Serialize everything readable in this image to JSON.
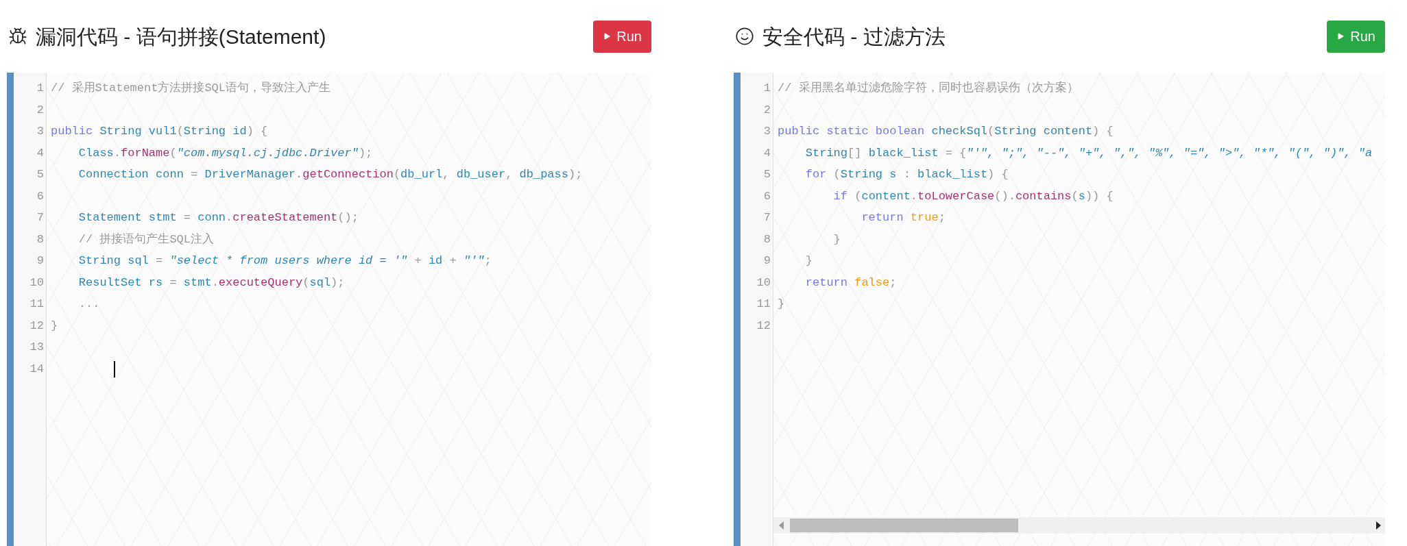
{
  "panels": [
    {
      "title": "漏洞代码 - 语句拼接(Statement)",
      "button": {
        "label": "Run"
      },
      "lines": [
        {
          "number": "1",
          "cursor": false,
          "tokens": [
            {
              "kind": "comment",
              "text": "// 采用Statement方法拼接SQL语句，导致注入产生"
            }
          ]
        },
        {
          "number": "2",
          "cursor": false
        },
        {
          "number": "3",
          "cursor": false,
          "tokens": [
            {
              "kind": "keyword",
              "text": "public "
            },
            {
              "kind": "type",
              "text": "String vul1"
            },
            {
              "kind": "punct",
              "text": "("
            },
            {
              "kind": "type",
              "text": "String id"
            },
            {
              "kind": "punct",
              "text": ") {"
            }
          ]
        },
        {
          "number": "4",
          "cursor": false,
          "tokens": [
            {
              "kind": "type",
              "text": "    Class"
            },
            {
              "kind": "punct",
              "text": "."
            },
            {
              "kind": "method",
              "text": "forName"
            },
            {
              "kind": "punct",
              "text": "("
            },
            {
              "kind": "string",
              "text": "\"com.mysql.cj.jdbc.Driver\""
            },
            {
              "kind": "punct",
              "text": ");"
            }
          ]
        },
        {
          "number": "5",
          "cursor": false,
          "tokens": [
            {
              "kind": "type",
              "text": "    Connection conn "
            },
            {
              "kind": "punct",
              "text": "= "
            },
            {
              "kind": "type",
              "text": "DriverManager"
            },
            {
              "kind": "punct",
              "text": "."
            },
            {
              "kind": "method",
              "text": "getConnection"
            },
            {
              "kind": "punct",
              "text": "("
            },
            {
              "kind": "type",
              "text": "db_url"
            },
            {
              "kind": "punct",
              "text": ", "
            },
            {
              "kind": "type",
              "text": "db_user"
            },
            {
              "kind": "punct",
              "text": ", "
            },
            {
              "kind": "type",
              "text": "db_pass"
            },
            {
              "kind": "punct",
              "text": ");"
            }
          ]
        },
        {
          "number": "6",
          "cursor": false
        },
        {
          "number": "7",
          "cursor": false,
          "tokens": [
            {
              "kind": "type",
              "text": "    Statement stmt "
            },
            {
              "kind": "punct",
              "text": "= "
            },
            {
              "kind": "type",
              "text": "conn"
            },
            {
              "kind": "punct",
              "text": "."
            },
            {
              "kind": "method",
              "text": "createStatement"
            },
            {
              "kind": "punct",
              "text": "();"
            }
          ]
        },
        {
          "number": "8",
          "cursor": false,
          "tokens": [
            {
              "kind": "comment",
              "text": "    // 拼接语句产生SQL注入"
            }
          ]
        },
        {
          "number": "9",
          "cursor": false,
          "tokens": [
            {
              "kind": "type",
              "text": "    String sql "
            },
            {
              "kind": "punct",
              "text": "= "
            },
            {
              "kind": "string",
              "text": "\"select * from users where id = '\""
            },
            {
              "kind": "punct",
              "text": " + "
            },
            {
              "kind": "type",
              "text": "id"
            },
            {
              "kind": "punct",
              "text": " + "
            },
            {
              "kind": "string",
              "text": "\"'\""
            },
            {
              "kind": "punct",
              "text": ";"
            }
          ]
        },
        {
          "number": "10",
          "cursor": false,
          "tokens": [
            {
              "kind": "type",
              "text": "    ResultSet rs "
            },
            {
              "kind": "punct",
              "text": "= "
            },
            {
              "kind": "type",
              "text": "stmt"
            },
            {
              "kind": "punct",
              "text": "."
            },
            {
              "kind": "method",
              "text": "executeQuery"
            },
            {
              "kind": "punct",
              "text": "("
            },
            {
              "kind": "type",
              "text": "sql"
            },
            {
              "kind": "punct",
              "text": ");"
            }
          ]
        },
        {
          "number": "11",
          "cursor": false,
          "tokens": [
            {
              "kind": "punct",
              "text": "    ..."
            }
          ]
        },
        {
          "number": "12",
          "cursor": false,
          "tokens": [
            {
              "kind": "punct",
              "text": "}"
            }
          ]
        },
        {
          "number": "13",
          "cursor": false
        },
        {
          "number": "14",
          "cursor": true
        }
      ]
    },
    {
      "title": "安全代码 - 过滤方法",
      "button": {
        "label": "Run"
      },
      "lines": [
        {
          "number": "1",
          "cursor": false,
          "tokens": [
            {
              "kind": "comment",
              "text": "// 采用黑名单过滤危险字符，同时也容易误伤（次方案）"
            }
          ]
        },
        {
          "number": "2",
          "cursor": false
        },
        {
          "number": "3",
          "cursor": false,
          "tokens": [
            {
              "kind": "keyword",
              "text": "public static boolean "
            },
            {
              "kind": "type",
              "text": "checkSql"
            },
            {
              "kind": "punct",
              "text": "("
            },
            {
              "kind": "type",
              "text": "String content"
            },
            {
              "kind": "punct",
              "text": ") {"
            }
          ]
        },
        {
          "number": "4",
          "cursor": false,
          "tokens": [
            {
              "kind": "type",
              "text": "    String"
            },
            {
              "kind": "punct",
              "text": "[] "
            },
            {
              "kind": "type",
              "text": "black_list "
            },
            {
              "kind": "punct",
              "text": "= {"
            },
            {
              "kind": "string",
              "text": "\"'\", \";\", \"--\", \"+\", \",\", \"%\", \"=\", \">\", \"*\", \"(\", \")\", \"a"
            }
          ]
        },
        {
          "number": "5",
          "cursor": false,
          "tokens": [
            {
              "kind": "keyword",
              "text": "    for"
            },
            {
              "kind": "punct",
              "text": " ("
            },
            {
              "kind": "type",
              "text": "String s "
            },
            {
              "kind": "punct",
              "text": ": "
            },
            {
              "kind": "type",
              "text": "black_list"
            },
            {
              "kind": "punct",
              "text": ") {"
            }
          ]
        },
        {
          "number": "6",
          "cursor": false,
          "tokens": [
            {
              "kind": "keyword",
              "text": "        if"
            },
            {
              "kind": "punct",
              "text": " ("
            },
            {
              "kind": "type",
              "text": "content"
            },
            {
              "kind": "punct",
              "text": "."
            },
            {
              "kind": "method",
              "text": "toLowerCase"
            },
            {
              "kind": "punct",
              "text": "()."
            },
            {
              "kind": "method",
              "text": "contains"
            },
            {
              "kind": "punct",
              "text": "("
            },
            {
              "kind": "type",
              "text": "s"
            },
            {
              "kind": "punct",
              "text": ")) {"
            }
          ]
        },
        {
          "number": "7",
          "cursor": false,
          "tokens": [
            {
              "kind": "keyword",
              "text": "            return "
            },
            {
              "kind": "atom",
              "text": "true"
            },
            {
              "kind": "punct",
              "text": ";"
            }
          ]
        },
        {
          "number": "8",
          "cursor": false,
          "tokens": [
            {
              "kind": "punct",
              "text": "        }"
            }
          ]
        },
        {
          "number": "9",
          "cursor": false,
          "tokens": [
            {
              "kind": "punct",
              "text": "    }"
            }
          ]
        },
        {
          "number": "10",
          "cursor": false,
          "tokens": [
            {
              "kind": "keyword",
              "text": "    return "
            },
            {
              "kind": "atom",
              "text": "false"
            },
            {
              "kind": "punct",
              "text": ";"
            }
          ]
        },
        {
          "number": "11",
          "cursor": false,
          "tokens": [
            {
              "kind": "punct",
              "text": "}"
            }
          ]
        },
        {
          "number": "12",
          "cursor": false
        }
      ]
    }
  ]
}
